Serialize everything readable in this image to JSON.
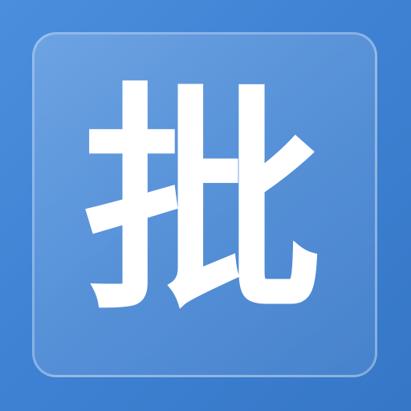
{
  "icon": {
    "character": "批",
    "background_color": "#3f82d3",
    "tile_color": "#5f99dd",
    "glyph_color": "#ffffff"
  }
}
